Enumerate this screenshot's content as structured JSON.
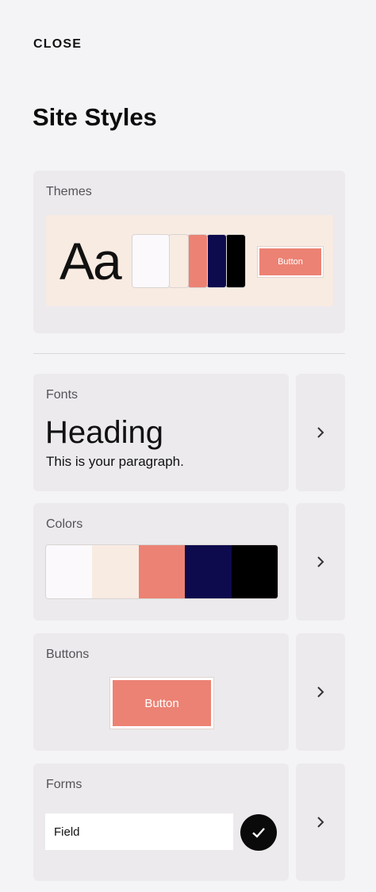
{
  "header": {
    "close_label": "CLOSE",
    "title": "Site Styles"
  },
  "themes": {
    "label": "Themes",
    "sample_text": "Aa",
    "button_label": "Button",
    "swatches": [
      "#fbf9fb",
      "#f8ebe2",
      "#ec8274",
      "#0d0a4e",
      "#000000"
    ]
  },
  "fonts": {
    "label": "Fonts",
    "heading": "Heading",
    "paragraph": "This is your paragraph."
  },
  "colors": {
    "label": "Colors",
    "swatches": [
      "#fbf9fb",
      "#f8ebe2",
      "#ec8274",
      "#0d0a4e",
      "#000000"
    ]
  },
  "buttons": {
    "label": "Buttons",
    "button_label": "Button"
  },
  "forms": {
    "label": "Forms",
    "field_value": "Field"
  },
  "icons": {
    "arrow": "chevron-right-icon",
    "check": "checkmark-icon"
  }
}
